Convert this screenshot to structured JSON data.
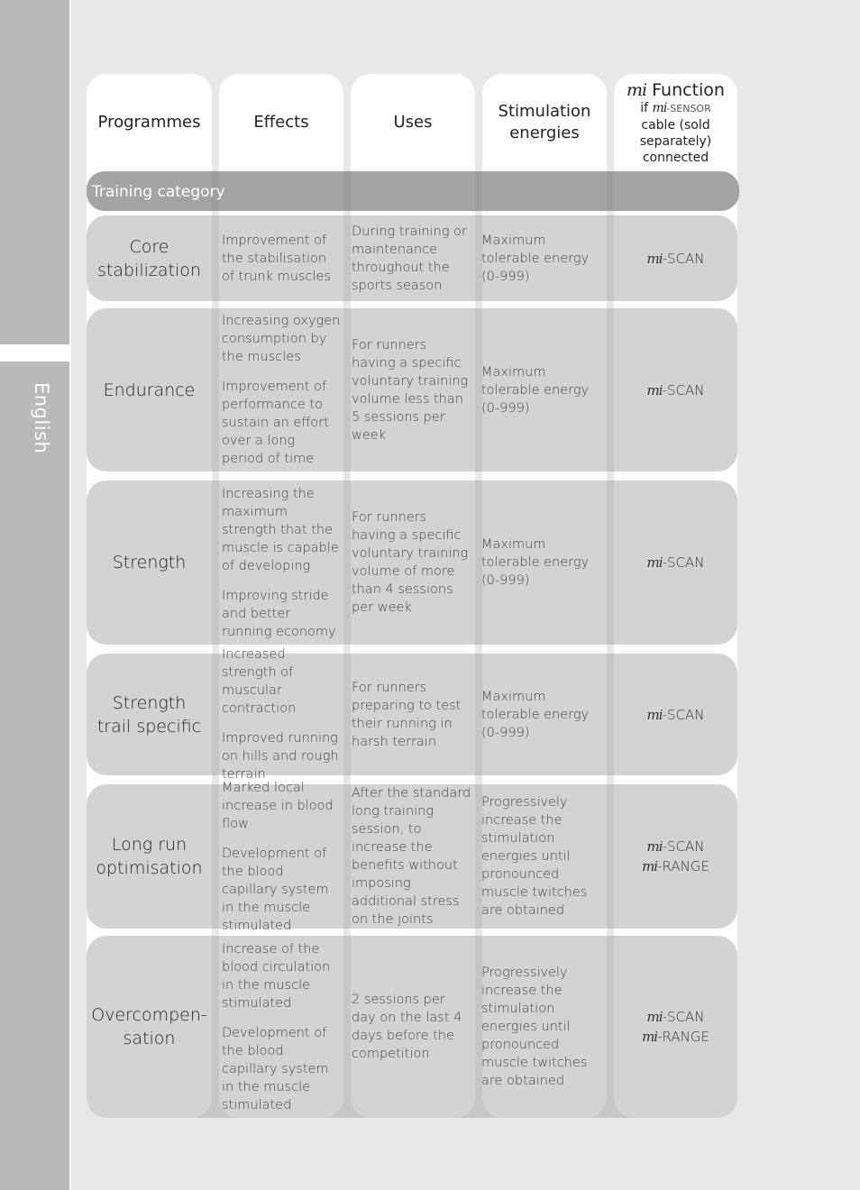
{
  "sidebar": {
    "language": "English"
  },
  "header": {
    "programmes": "Programmes",
    "effects": "Effects",
    "uses": "Uses",
    "energies_line1": "Stimulation",
    "energies_line2": "energies",
    "mi_logo": "mi",
    "mi_function": "Function",
    "mi_if": "if",
    "mi_sensor_prefix": "mi",
    "mi_sensor": "-SENSOR",
    "mi_line3": "cable (sold",
    "mi_line4": "separately)",
    "mi_line5": "connected"
  },
  "category": {
    "label": "Training category"
  },
  "rows": [
    {
      "programme": [
        "Core",
        "stabilization"
      ],
      "effects": [
        "Improvement of the stabilisation of trunk muscles"
      ],
      "uses": "During training or maintenance throughout the sports season",
      "energies": "Maximum tolerable energy (0-999)",
      "mi": [
        "-SCAN"
      ]
    },
    {
      "programme": [
        "Endurance"
      ],
      "effects": [
        "Increasing oxygen consumption by the muscles",
        "Improvement of performance to sustain an effort over a long period of time"
      ],
      "uses": "For runners having a specific voluntary training volume less than 5 sessions per week",
      "energies": "Maximum tolerable energy (0-999)",
      "mi": [
        "-SCAN"
      ]
    },
    {
      "programme": [
        "Strength"
      ],
      "effects": [
        "Increasing the maximum strength that the muscle is capable of developing",
        "Improving stride and better running economy"
      ],
      "uses": "For runners having a specific voluntary training volume of more than 4 sessions per week",
      "energies": "Maximum tolerable energy (0-999)",
      "mi": [
        "-SCAN"
      ]
    },
    {
      "programme": [
        "Strength",
        "trail specific"
      ],
      "effects": [
        "Increased strength of muscular contraction",
        "Improved running on hills and rough terrain"
      ],
      "uses": "For runners preparing to test their running in harsh terrain",
      "energies": "Maximum tolerable energy (0-999)",
      "mi": [
        "-SCAN"
      ]
    },
    {
      "programme": [
        "Long run",
        "optimisation"
      ],
      "effects": [
        "Marked local increase in blood flow",
        "Development of the blood capillary system in the muscle stimulated"
      ],
      "uses": "After the standard long training session, to increase the benefits without imposing additional stress on the joints",
      "energies": "Progressively increase the stimulation energies until pronounced muscle twitches are obtained",
      "mi": [
        "-SCAN",
        "-RANGE"
      ]
    },
    {
      "programme": [
        "Overcompen-",
        "sation"
      ],
      "effects": [
        "Increase of the blood circulation in the muscle stimulated",
        "Development of the blood capillary system in the muscle stimulated"
      ],
      "uses": "2 sessions per day on the last 4 days before the competition",
      "energies": "Progressively increase the stimulation energies until pronounced muscle twitches are obtained",
      "mi": [
        "-SCAN",
        "-RANGE"
      ]
    }
  ]
}
